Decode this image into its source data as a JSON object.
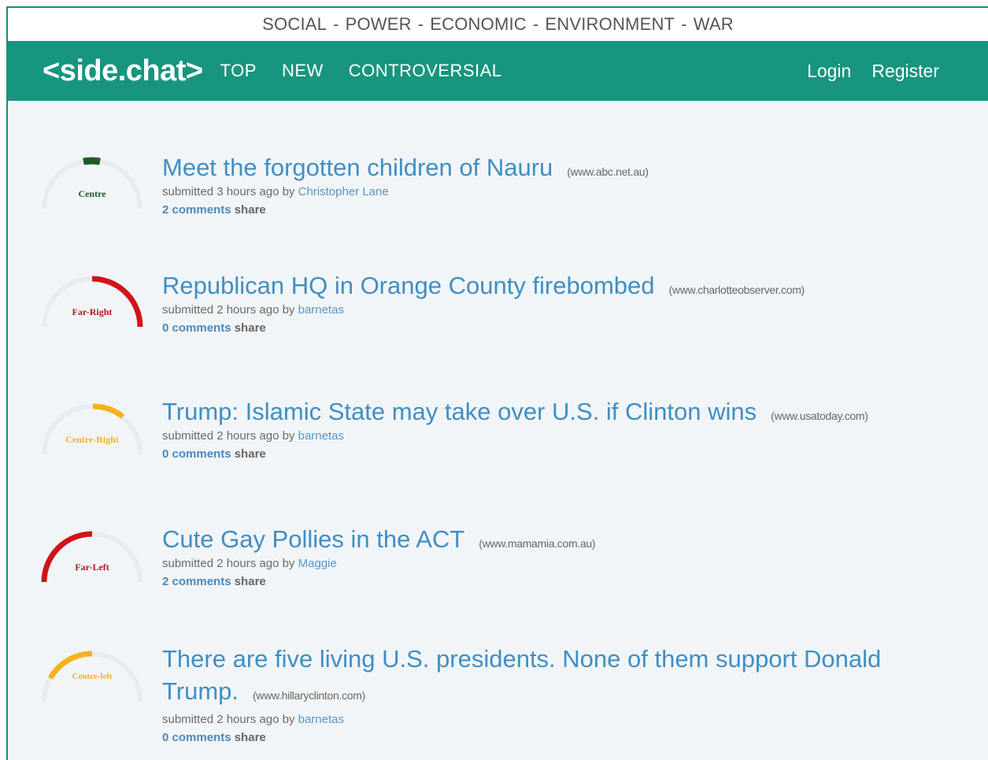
{
  "topics": [
    "SOCIAL",
    "POWER",
    "ECONOMIC",
    "ENVIRONMENT",
    "WAR"
  ],
  "topics_separator": "-",
  "navbar": {
    "brand": "<side.chat>",
    "links": [
      "TOP",
      "NEW",
      "CONTROVERSIAL"
    ],
    "login": "Login",
    "register": "Register"
  },
  "colors": {
    "brand_teal": "#17957e",
    "link_blue": "#3f8fc3",
    "centre": "#1f5a2a",
    "far_right": "#d0141a",
    "centre_right": "#f4b21b",
    "far_left": "#d0141a",
    "centre_left": "#f4b21b",
    "gauge_track": "#e9ecef"
  },
  "posts": [
    {
      "bias_label": "Centre",
      "title": "Meet the forgotten children of Nauru",
      "domain": "(www.abc.net.au)",
      "submitted_prefix": "submitted 3 hours ago by",
      "author": "Christopher Lane",
      "comments": "2 comments",
      "share": "share"
    },
    {
      "bias_label": "Far-Right",
      "title": "Republican HQ in Orange County firebombed",
      "domain": "(www.charlotteobserver.com)",
      "submitted_prefix": "submitted 2 hours ago by",
      "author": "barnetas",
      "comments": "0 comments",
      "share": "share"
    },
    {
      "bias_label": "Centre-Right",
      "title": "Trump: Islamic State may take over U.S. if Clinton wins",
      "domain": "(www.usatoday.com)",
      "submitted_prefix": "submitted 2 hours ago by",
      "author": "barnetas",
      "comments": "0 comments",
      "share": "share"
    },
    {
      "bias_label": "Far-Left",
      "title": "Cute Gay Pollies in the ACT",
      "domain": "(www.mamamia.com.au)",
      "submitted_prefix": "submitted 2 hours ago by",
      "author": "Maggie",
      "comments": "2 comments",
      "share": "share"
    },
    {
      "bias_label": "Centre-left",
      "title": "There are five living U.S. presidents. None of them support Donald Trump.",
      "domain": "(www.hillaryclinton.com)",
      "submitted_prefix": "submitted 2 hours ago by",
      "author": "barnetas",
      "comments": "0 comments",
      "share": "share"
    }
  ]
}
